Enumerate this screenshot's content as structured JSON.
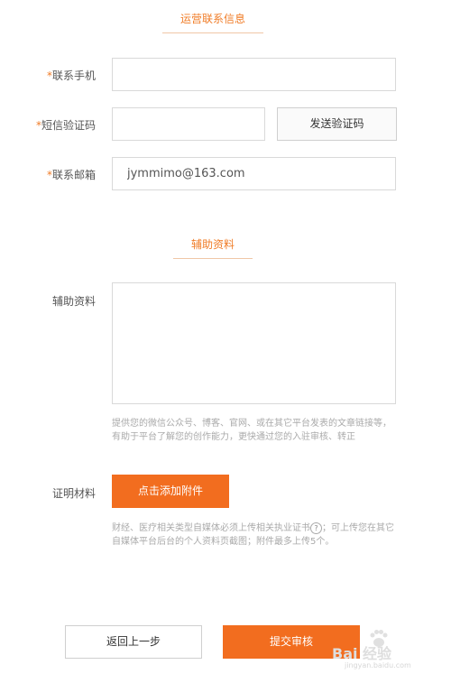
{
  "section_ops": {
    "title": "运营联系信息"
  },
  "phone": {
    "required_mark": "*",
    "label": "联系手机",
    "value": "",
    "placeholder": ""
  },
  "sms": {
    "required_mark": "*",
    "label": "短信验证码",
    "value": "",
    "send_button": "发送验证码"
  },
  "email": {
    "required_mark": "*",
    "label": "联系邮箱",
    "value": "jymmimo@163.com"
  },
  "section_aux": {
    "title": "辅助资料"
  },
  "aux": {
    "label": "辅助资料",
    "value": "",
    "hint": "提供您的微信公众号、博客、官网、或在其它平台发表的文章链接等，有助于平台了解您的创作能力，更快通过您的入驻审核、转正"
  },
  "proof": {
    "label": "证明材料",
    "button": "点击添加附件",
    "hint_part1": "财经、医疗相关类型自媒体必须上传相关执业证书",
    "hint_icon": "?",
    "hint_part2": "；可上传您在其它自媒体平台后台的个人资料页截图；附件最多上传5个。"
  },
  "footer": {
    "back_button": "返回上一步",
    "submit_button": "提交审核"
  },
  "watermark": {
    "logo_text": "Bai 经验",
    "url": "jingyan.baidu.com"
  },
  "colors": {
    "accent": "#f26d1f",
    "section_title": "#f07c27",
    "hint": "#aaaaaa"
  },
  "icons": {
    "hint_help": "question-circle-icon",
    "watermark": "baidu-paw-icon"
  }
}
